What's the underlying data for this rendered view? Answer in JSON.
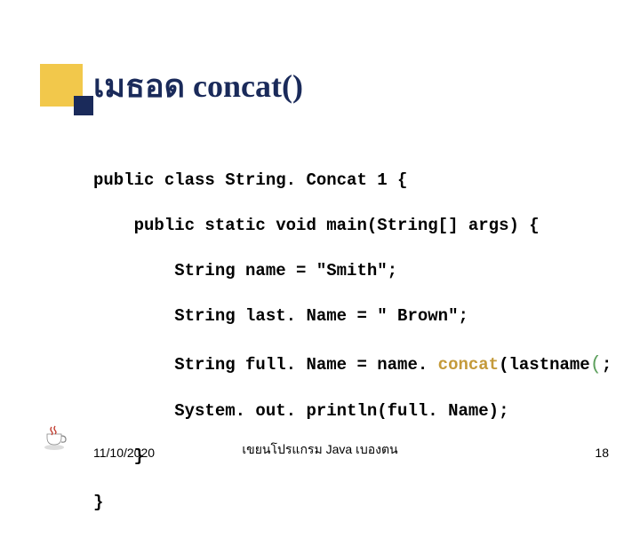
{
  "title": "เมธอด concat()",
  "code": {
    "l1a": "public class String. Concat 1 {",
    "l2a": "    public static void main(String[] args) {",
    "l3a": "        String name = \"Smith\";",
    "l4a": "        String last. Name = \" Brown\";",
    "l5a": "        String full. Name = name. ",
    "l5b": "concat",
    "l5c": "(lastname",
    "l5d": "(",
    "l5e": ";",
    "l6a": "        System. out. println(full. Name);",
    "l7a": "    }",
    "l8a": "}"
  },
  "footer": {
    "date": "11/10/2020",
    "center": "เขยนโปรแกรม   Java เบองตน",
    "page": "18"
  }
}
